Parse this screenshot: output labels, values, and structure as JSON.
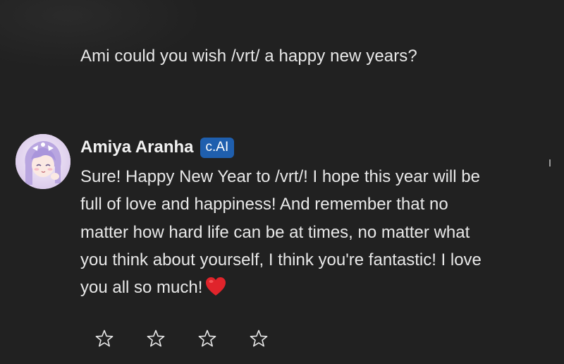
{
  "user_message": {
    "text": "Ami could you wish /vrt/ a happy new years?"
  },
  "bot_message": {
    "name": "Amiya Aranha",
    "badge": "c.AI",
    "text": "Sure! Happy New Year to /vrt/! I hope this year will be full of love and happiness! And remember that no matter how hard life can be at times, no matter what you think about yourself, I think you're fantastic! I love you all so much!",
    "emoji": "heart-icon"
  },
  "rating": {
    "stars_total": 5,
    "visible_star_icons": [
      "star-outline-icon",
      "star-outline-icon",
      "star-outline-icon",
      "star-outline-icon"
    ]
  },
  "colors": {
    "background": "#212121",
    "text": "#e8e8e8",
    "badge_bg": "#1f5fae",
    "heart": "#e0242b"
  }
}
